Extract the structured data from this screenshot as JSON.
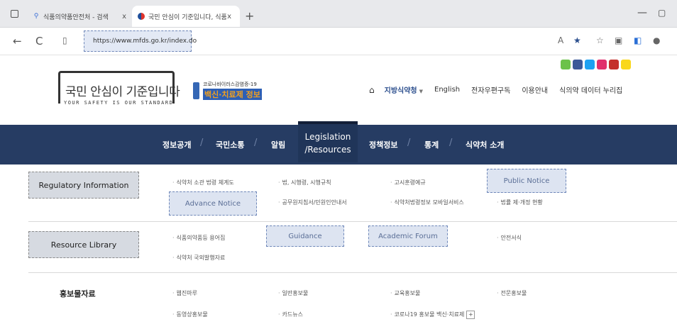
{
  "browser": {
    "tabs": [
      {
        "title": "식품의약품안전처 - 검색",
        "active": false
      },
      {
        "title": "국민 안심이 기준입니다, 식품의약",
        "active": true
      }
    ],
    "new_tab": "+",
    "close": "x",
    "url": "https://www.mfds.go.kr/index.do",
    "back": "←",
    "refresh": "C"
  },
  "header": {
    "slogan_main": "국민 안심이 기준입니다",
    "slogan_sub": "YOUR SAFETY IS OUR STANDARD",
    "vaccine_top": "코로나바이러스감염증-19",
    "vaccine_bottom": "백신·치료제 정보",
    "util_nav": {
      "home_icon": "⌂",
      "items": [
        "지방식약청",
        "English",
        "전자우편구독",
        "이용안내",
        "식의약 데이터 누리집"
      ]
    },
    "social_colors": [
      "#6cc24a",
      "#3b5998",
      "#1da1f2",
      "#e1306c",
      "#c4302b",
      "#f9d71c"
    ]
  },
  "gnb": {
    "items": [
      "정보공개",
      "국민소통",
      "알림",
      "정책정보",
      "통계",
      "식약처 소개"
    ],
    "active_line1": "Legislation",
    "active_line2": "/Resources",
    "active_bg": "#203559",
    "bar_bg": "#263c63"
  },
  "mega": {
    "row1": {
      "category": "Regulatory Information",
      "links": {
        "a": "식약처 소관 법령 체계도",
        "b": "법, 시행령, 시행규칙",
        "c": "고시훈령예규",
        "d": "공무원지침서/민원인안내서",
        "e": "식약처법령정보 모바일서비스",
        "f": "법률 제·개정 현황"
      },
      "advance_notice": "Advance Notice",
      "public_notice": "Public Notice"
    },
    "row2": {
      "category": "Resource Library",
      "links": {
        "a": "식품의약품등 용어집",
        "b": "식약처 국외발행자료",
        "c": "안전서식"
      },
      "guidance": "Guidance",
      "academic_forum": "Academic Forum"
    },
    "row3": {
      "category": "홍보물자료",
      "links": {
        "a": "웹진마루",
        "b": "동영상홍보물",
        "c": "일반홍보물",
        "d": "카드뉴스",
        "e": "교육홍보물",
        "f": "코로나19 홍보물 백신·치료제",
        "g": "전문홍보물"
      },
      "plus": "+"
    }
  }
}
